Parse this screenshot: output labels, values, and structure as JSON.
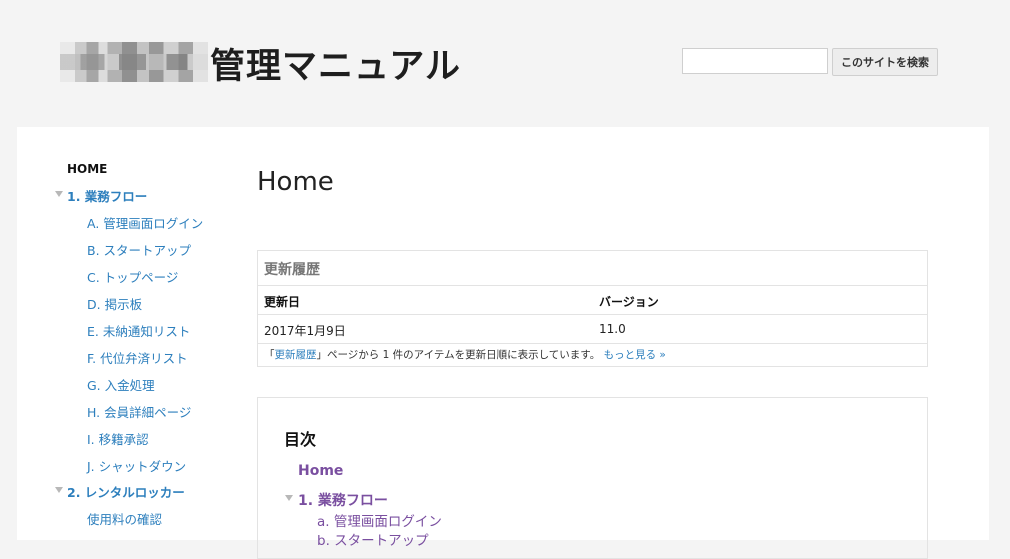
{
  "header": {
    "site_title": "管理マニュアル",
    "search_value": "",
    "search_button": "このサイトを検索"
  },
  "sidebar": {
    "home": "HOME",
    "section1": "1. 業務フロー",
    "section1_items": [
      "A. 管理画面ログイン",
      "B. スタートアップ",
      "C. トップページ",
      "D. 掲示板",
      "E. 未納通知リスト",
      "F. 代位弁済リスト",
      "G. 入金処理",
      "H. 会員詳細ページ",
      "I. 移籍承認",
      "J. シャットダウン"
    ],
    "section2": "2. レンタルロッカー",
    "section2_items": [
      "使用料の確認"
    ]
  },
  "main": {
    "page_title": "Home",
    "history": {
      "title": "更新履歴",
      "columns": [
        "更新日",
        "バージョン"
      ],
      "rows": [
        [
          "2017年1月9日",
          "11.0"
        ]
      ],
      "footer_prefix": "「",
      "footer_link": "更新履歴",
      "footer_text": "」ページから 1 件のアイテムを更新日順に表示しています。",
      "more_link": "もっと見る »"
    },
    "toc": {
      "title": "目次",
      "home": "Home",
      "section1": "1. 業務フロー",
      "items": [
        "a. 管理画面ログイン",
        "b. スタートアップ"
      ]
    }
  },
  "colors": {
    "link": "#2d7fbd",
    "toc_link": "#7a4fa0",
    "page_bg": "#f4f4f4"
  }
}
